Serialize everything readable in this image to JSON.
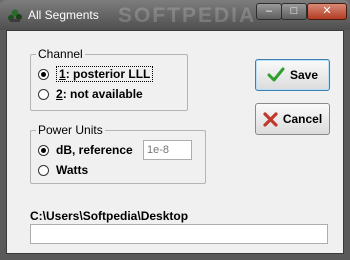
{
  "window": {
    "title": "All Segments",
    "watermark": "SOFTPEDIA",
    "minimize_glyph": "–",
    "maximize_glyph": "□",
    "close_glyph": "✕"
  },
  "channel": {
    "legend": "Channel",
    "options": [
      {
        "hotkey": "1",
        "text": ": posterior LLL",
        "selected": true
      },
      {
        "hotkey": "2",
        "text": ": not available",
        "selected": false
      }
    ]
  },
  "power_units": {
    "legend": "Power Units",
    "options": [
      {
        "text": "dB, reference",
        "selected": true
      },
      {
        "text": "Watts",
        "selected": false
      }
    ],
    "reference_value": "1e-8"
  },
  "buttons": {
    "save": "Save",
    "cancel": "Cancel"
  },
  "path": {
    "label": "C:\\Users\\Softpedia\\Desktop",
    "value": ""
  },
  "colors": {
    "save_icon": "#2e9e2e",
    "cancel_icon": "#c0392b"
  },
  "icons": [
    "app-icon",
    "checkmark-icon",
    "x-icon"
  ]
}
